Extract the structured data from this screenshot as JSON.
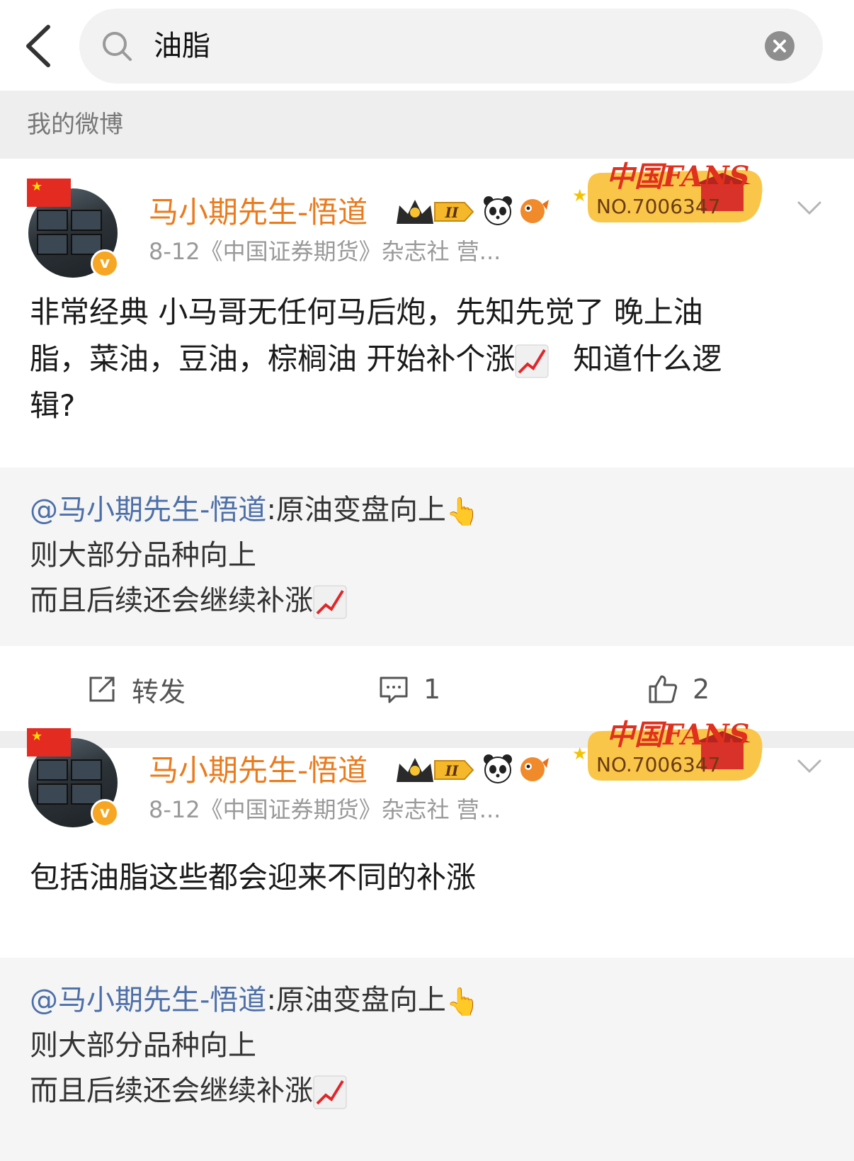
{
  "search": {
    "query": "油脂"
  },
  "section": {
    "title": "我的微博"
  },
  "posts": [
    {
      "author": "马小期先生-悟道",
      "badge_level": "II",
      "fans_badge": {
        "title": "中国FANS",
        "number": "NO.7006347"
      },
      "meta": "8-12《中国证券期货》杂志社 营...",
      "text_lines": [
        "非常经典 小马哥无任何马后炮，先知先觉了 晚上油",
        "脂，菜油，豆油，棕榈油 开始补个涨",
        "辑?"
      ],
      "text_line2_tail": "知道什么逻",
      "quote": {
        "mention": "@马小期先生-悟道",
        "line1_rest": ":原油变盘向上",
        "line2": "则大部分品种向上",
        "line3": "而且后续还会继续补涨"
      },
      "actions": {
        "repost": "转发",
        "comments": "1",
        "likes": "2"
      }
    },
    {
      "author": "马小期先生-悟道",
      "badge_level": "II",
      "fans_badge": {
        "title": "中国FANS",
        "number": "NO.7006347"
      },
      "meta": "8-12《中国证券期货》杂志社 营...",
      "text": "包括油脂这些都会迎来不同的补涨",
      "quote": {
        "mention": "@马小期先生-悟道",
        "line1_rest": ":原油变盘向上",
        "line2": "则大部分品种向上",
        "line3": "而且后续还会继续补涨"
      }
    }
  ],
  "colors": {
    "username": "#ea7b1e",
    "mention": "#4d6fa8",
    "verified": "#f6a623"
  },
  "icons": [
    "back-arrow-icon",
    "search-icon",
    "clear-icon",
    "chevron-down-icon",
    "repost-icon",
    "comment-icon",
    "like-icon",
    "chart-increasing-emoji",
    "pointing-up-emoji"
  ]
}
